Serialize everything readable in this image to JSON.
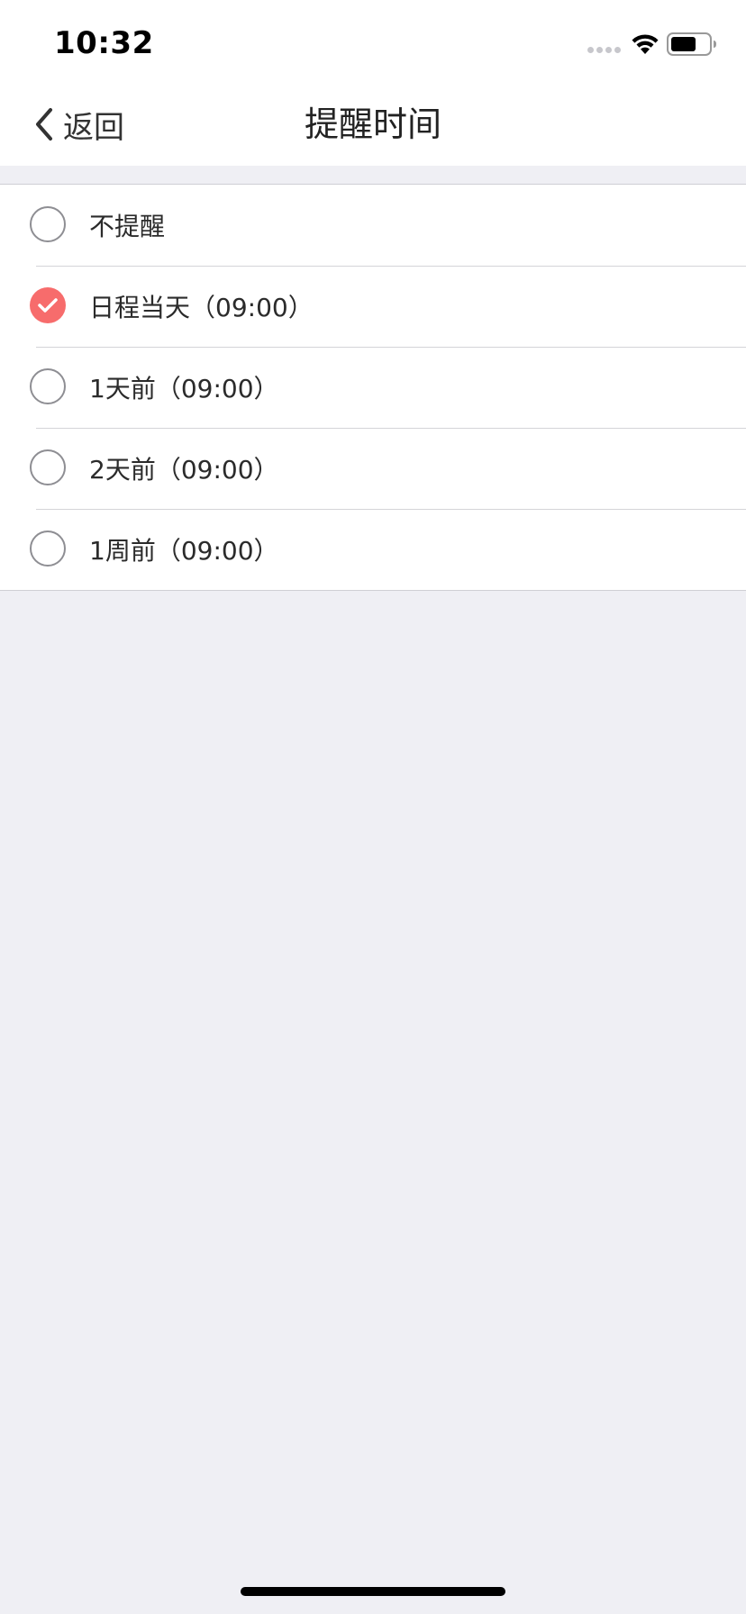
{
  "status_bar": {
    "time": "10:32",
    "icons": [
      "cellular-signal-icon",
      "wifi-icon",
      "battery-icon"
    ]
  },
  "nav": {
    "back_label": "返回",
    "title": "提醒时间",
    "back_icon": "chevron-left-icon"
  },
  "options": [
    {
      "label": "不提醒",
      "selected": false
    },
    {
      "label": "日程当天（09:00）",
      "selected": true
    },
    {
      "label": "1天前（09:00）",
      "selected": false
    },
    {
      "label": "2天前（09:00）",
      "selected": false
    },
    {
      "label": "1周前（09:00）",
      "selected": false
    }
  ],
  "colors": {
    "accent": "#f76c6c",
    "background": "#efeff4",
    "surface": "#ffffff"
  }
}
